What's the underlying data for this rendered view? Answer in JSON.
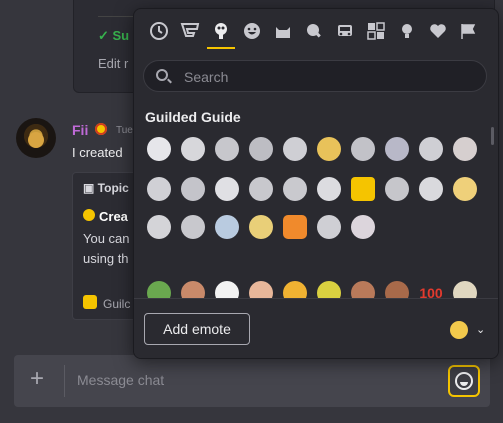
{
  "background_chat": {
    "top_card": {
      "success_text": "✓ Su",
      "edit_text": "Edit r"
    },
    "message": {
      "author": "Fii",
      "time": "Tue",
      "text": "I created",
      "embed": {
        "title": "Topic",
        "heading": "Crea",
        "body_line1": "You can",
        "body_line2": "using th",
        "footer": "Guilc"
      }
    }
  },
  "composer": {
    "placeholder": "Message chat",
    "add_icon": "plus-icon",
    "emoji_icon": "smile-icon"
  },
  "emoji_picker": {
    "categories": [
      {
        "icon": "clock-icon",
        "active": false
      },
      {
        "icon": "guilded-icon",
        "active": false
      },
      {
        "icon": "mushroom-cloud-icon",
        "active": true
      },
      {
        "icon": "smiley-icon",
        "active": false
      },
      {
        "icon": "cat-icon",
        "active": false
      },
      {
        "icon": "food-icon",
        "active": false
      },
      {
        "icon": "car-icon",
        "active": false
      },
      {
        "icon": "dice-icon",
        "active": false
      },
      {
        "icon": "bulb-icon",
        "active": false
      },
      {
        "icon": "heart-icon",
        "active": false
      },
      {
        "icon": "flag-icon",
        "active": false
      }
    ],
    "search_placeholder": "Search",
    "section_title": "Guilded Guide",
    "add_emote_label": "Add emote",
    "skin_tone_icon": "rock-hand-icon",
    "colors": {
      "accent": "#f5c400",
      "panel": "#2a2a30"
    }
  }
}
